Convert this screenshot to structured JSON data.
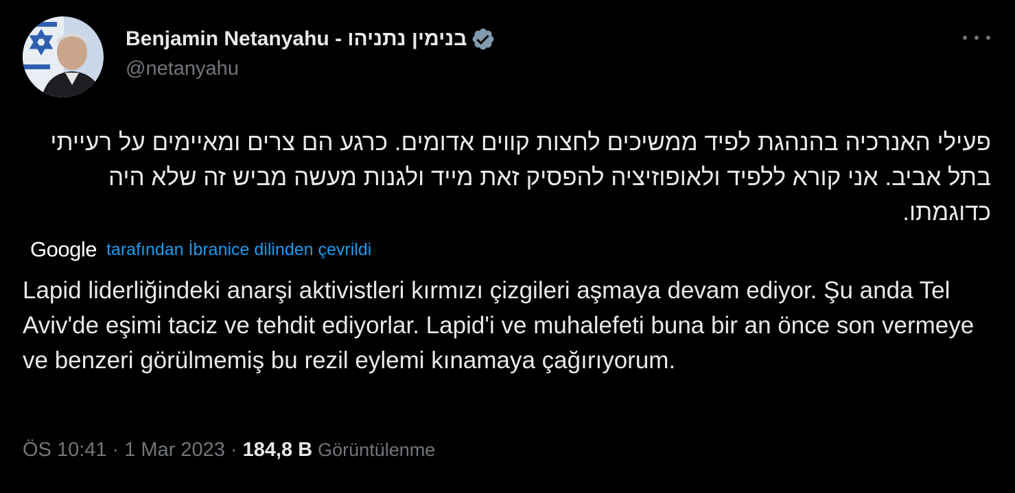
{
  "author": {
    "display_name": "Benjamin Netanyahu - בנימין נתניהו",
    "handle": "@netanyahu",
    "verified_icon": "verified-badge-icon",
    "avatar": "profile-photo"
  },
  "tweet": {
    "original_text": "פעילי האנרכיה בהנהגת לפיד ממשיכים לחצות קווים אדומים. כרגע הם צרים ומאיימים על רעייתי בתל אביב. אני קורא ללפיד ולאופוזיציה להפסיק זאת מייד ולגנות מעשה מביש זה שלא היה כדוגמתו.",
    "translation_provider": "Google",
    "translation_note": "tarafından İbranice dilinden çevrildi",
    "translated_text": "Lapid liderliğindeki anarşi aktivistleri kırmızı çizgileri aşmaya devam ediyor. Şu anda Tel Aviv'de eşimi taciz ve tehdit ediyorlar. Lapid'i ve muhalefeti buna bir an önce son vermeye ve benzeri görülmemiş bu rezil eylemi kınamaya çağırıyorum."
  },
  "meta": {
    "time": "ÖS 10:41",
    "separator": "·",
    "date": "1 Mar 2023",
    "views_count": "184,8 B",
    "views_label": "Görüntülenme"
  },
  "colors": {
    "background": "#000000",
    "text_primary": "#e7e9ea",
    "text_secondary": "#71767b",
    "link": "#1d9bf0",
    "verified_badge": "#829aab"
  }
}
